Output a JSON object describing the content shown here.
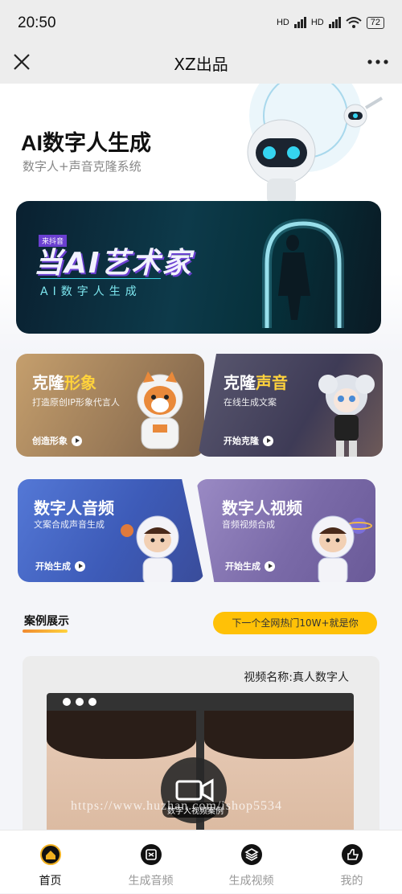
{
  "status_bar": {
    "time": "20:50",
    "network1": "HD",
    "network2": "HD",
    "battery": "72"
  },
  "nav": {
    "title": "XZ出品"
  },
  "hero": {
    "title": "AI数字人生成",
    "subtitle": "数字人+声音克隆系统",
    "banner": {
      "badge": "来抖音",
      "logo": "当AI艺术家",
      "tagline": "AI数字人生成"
    }
  },
  "cards": [
    {
      "title_a": "克隆",
      "title_b": "形象",
      "desc": "打造原创IP形象代言人",
      "action": "创造形象"
    },
    {
      "title_a": "克隆",
      "title_b": "声音",
      "desc": "在线生成文案",
      "action": "开始克隆"
    },
    {
      "title": "数字人音频",
      "desc": "文案合成声音生成",
      "action": "开始生成"
    },
    {
      "title": "数字人视频",
      "desc": "音频视频合成",
      "action": "开始生成"
    }
  ],
  "cases": {
    "section_title": "案例展示",
    "cta": "下一个全网热门10W+就是你",
    "video_name": "视频名称:真人数字人",
    "video_label": "数字人视频案例"
  },
  "watermark": "https://www.huzhan.com/ishop5534",
  "tabs": [
    {
      "label": "首页",
      "icon": "home-icon",
      "active": true
    },
    {
      "label": "生成音频",
      "icon": "audio-icon",
      "active": false
    },
    {
      "label": "生成视频",
      "icon": "layers-icon",
      "active": false
    },
    {
      "label": "我的",
      "icon": "thumbs-up-icon",
      "active": false
    }
  ],
  "colors": {
    "accent": "#ffc107",
    "card1": "#b08a5c",
    "card2": "#4a4560",
    "card3": "#3d5bb8",
    "card4": "#7a6aa8"
  }
}
